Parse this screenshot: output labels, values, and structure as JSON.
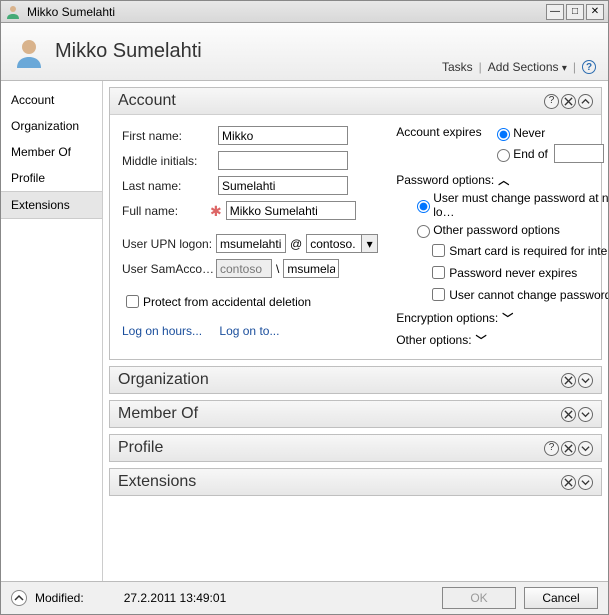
{
  "window_title": "Mikko Sumelahti",
  "header": {
    "title": "Mikko Sumelahti",
    "tasks": "Tasks",
    "add_sections": "Add Sections"
  },
  "sidebar": {
    "items": [
      "Account",
      "Organization",
      "Member Of",
      "Profile",
      "Extensions"
    ],
    "selected_index": 4
  },
  "sections": {
    "account": {
      "title": "Account",
      "first_name_label": "First name:",
      "first_name": "Mikko",
      "middle_label": "Middle initials:",
      "middle": "",
      "last_name_label": "Last name:",
      "last_name": "Sumelahti",
      "full_name_label": "Full name:",
      "full_name": "Mikko Sumelahti",
      "upn_label": "User UPN logon:",
      "upn_user": "msumelahti",
      "upn_domain": "contoso.",
      "sam_label": "User SamAcco…",
      "sam_domain": "contoso",
      "sam_user": "msumelal",
      "protect_label": "Protect from accidental deletion",
      "links": {
        "hours": "Log on hours...",
        "to": "Log on to..."
      },
      "expires": {
        "label": "Account expires",
        "never": "Never",
        "endof": "End of"
      },
      "pw": {
        "header": "Password options:",
        "must_change": "User must change password at next lo…",
        "other": "Other password options",
        "smart": "Smart card is required for interactiv…",
        "never_expires": "Password never expires",
        "cannot_change": "User cannot change password"
      },
      "enc": "Encryption options:",
      "other_opts": "Other options:"
    },
    "organization": "Organization",
    "memberof": "Member Of",
    "profile": "Profile",
    "extensions": "Extensions"
  },
  "footer": {
    "modified_label": "Modified:",
    "modified_value": "27.2.2011 13:49:01",
    "ok": "OK",
    "cancel": "Cancel"
  }
}
